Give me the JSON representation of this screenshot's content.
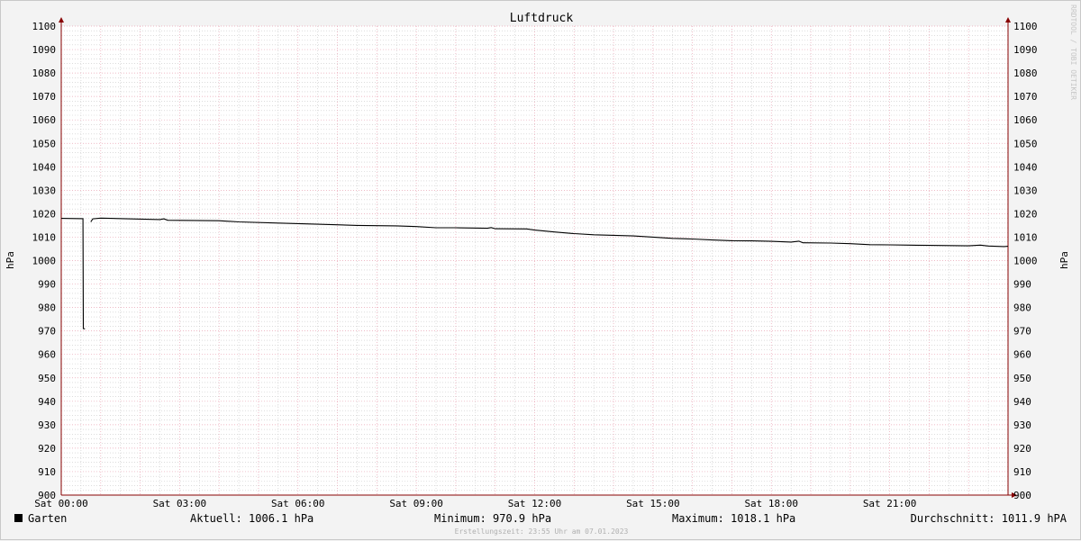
{
  "chart_data": {
    "type": "line",
    "title": "Luftdruck",
    "ylabel": "hPa",
    "ylabel_right": "hPa",
    "ylim": [
      900,
      1100
    ],
    "y_ticks": [
      900,
      910,
      920,
      930,
      940,
      950,
      960,
      970,
      980,
      990,
      1000,
      1010,
      1020,
      1030,
      1040,
      1050,
      1060,
      1070,
      1080,
      1090,
      1100
    ],
    "x_range_hours": [
      0,
      24
    ],
    "x_ticks": [
      {
        "hour": 0,
        "label": "Sat 00:00"
      },
      {
        "hour": 3,
        "label": "Sat 03:00"
      },
      {
        "hour": 6,
        "label": "Sat 06:00"
      },
      {
        "hour": 9,
        "label": "Sat 09:00"
      },
      {
        "hour": 12,
        "label": "Sat 12:00"
      },
      {
        "hour": 15,
        "label": "Sat 15:00"
      },
      {
        "hour": 18,
        "label": "Sat 18:00"
      },
      {
        "hour": 21,
        "label": "Sat 21:00"
      }
    ],
    "grid": true,
    "legend_position": "bottom-left",
    "series": [
      {
        "name": "Garten",
        "color": "#000000",
        "segments": [
          [
            [
              0,
              1018.0
            ],
            [
              0.55,
              1017.9
            ],
            [
              0.56,
              971.0
            ],
            [
              0.6,
              970.9
            ]
          ],
          [
            [
              0.75,
              1016.5
            ],
            [
              0.8,
              1017.8
            ],
            [
              1.0,
              1018.1
            ],
            [
              2.5,
              1017.5
            ],
            [
              2.6,
              1017.8
            ],
            [
              2.7,
              1017.2
            ],
            [
              4.0,
              1017.0
            ],
            [
              4.5,
              1016.5
            ],
            [
              5.5,
              1016.0
            ],
            [
              6.5,
              1015.5
            ],
            [
              7.5,
              1015.0
            ],
            [
              8.5,
              1014.8
            ],
            [
              9.0,
              1014.5
            ],
            [
              9.5,
              1014.0
            ],
            [
              10.0,
              1014.0
            ],
            [
              10.8,
              1013.8
            ],
            [
              10.9,
              1014.1
            ],
            [
              11.0,
              1013.6
            ],
            [
              11.8,
              1013.5
            ],
            [
              12.0,
              1013.0
            ],
            [
              12.5,
              1012.2
            ],
            [
              13.0,
              1011.5
            ],
            [
              13.5,
              1011.0
            ],
            [
              14.0,
              1010.8
            ],
            [
              14.5,
              1010.5
            ],
            [
              15.0,
              1010.0
            ],
            [
              15.5,
              1009.5
            ],
            [
              16.0,
              1009.2
            ],
            [
              16.5,
              1008.8
            ],
            [
              17.0,
              1008.5
            ],
            [
              17.5,
              1008.4
            ],
            [
              18.0,
              1008.2
            ],
            [
              18.5,
              1007.9
            ],
            [
              18.7,
              1008.3
            ],
            [
              18.8,
              1007.6
            ],
            [
              19.5,
              1007.5
            ],
            [
              20.0,
              1007.2
            ],
            [
              20.5,
              1006.8
            ],
            [
              21.0,
              1006.7
            ],
            [
              21.5,
              1006.6
            ],
            [
              22.0,
              1006.5
            ],
            [
              22.5,
              1006.4
            ],
            [
              23.0,
              1006.3
            ],
            [
              23.3,
              1006.6
            ],
            [
              23.5,
              1006.2
            ],
            [
              23.9,
              1006.0
            ],
            [
              24.0,
              1006.1
            ]
          ]
        ]
      }
    ]
  },
  "legend": {
    "series_name": "Garten",
    "swatch_color": "#000000"
  },
  "stats": {
    "current": "Aktuell: 1006.1 hPa",
    "minimum": "Minimum: 970.9 hPa",
    "maximum": "Maximum: 1018.1 hPa",
    "average": "Durchschnitt: 1011.9 hPA"
  },
  "footer_text": "Erstellungszeit: 23:55 Uhr am 07.01.2023",
  "watermark_text": "RRDTOOL / TOBI OETIKER",
  "colors": {
    "background": "#f3f3f3",
    "plot_background": "#ffffff",
    "major_grid": "#e9a3b3",
    "minor_grid": "#c8c8c8",
    "axis": "#880000",
    "line": "#000000"
  }
}
